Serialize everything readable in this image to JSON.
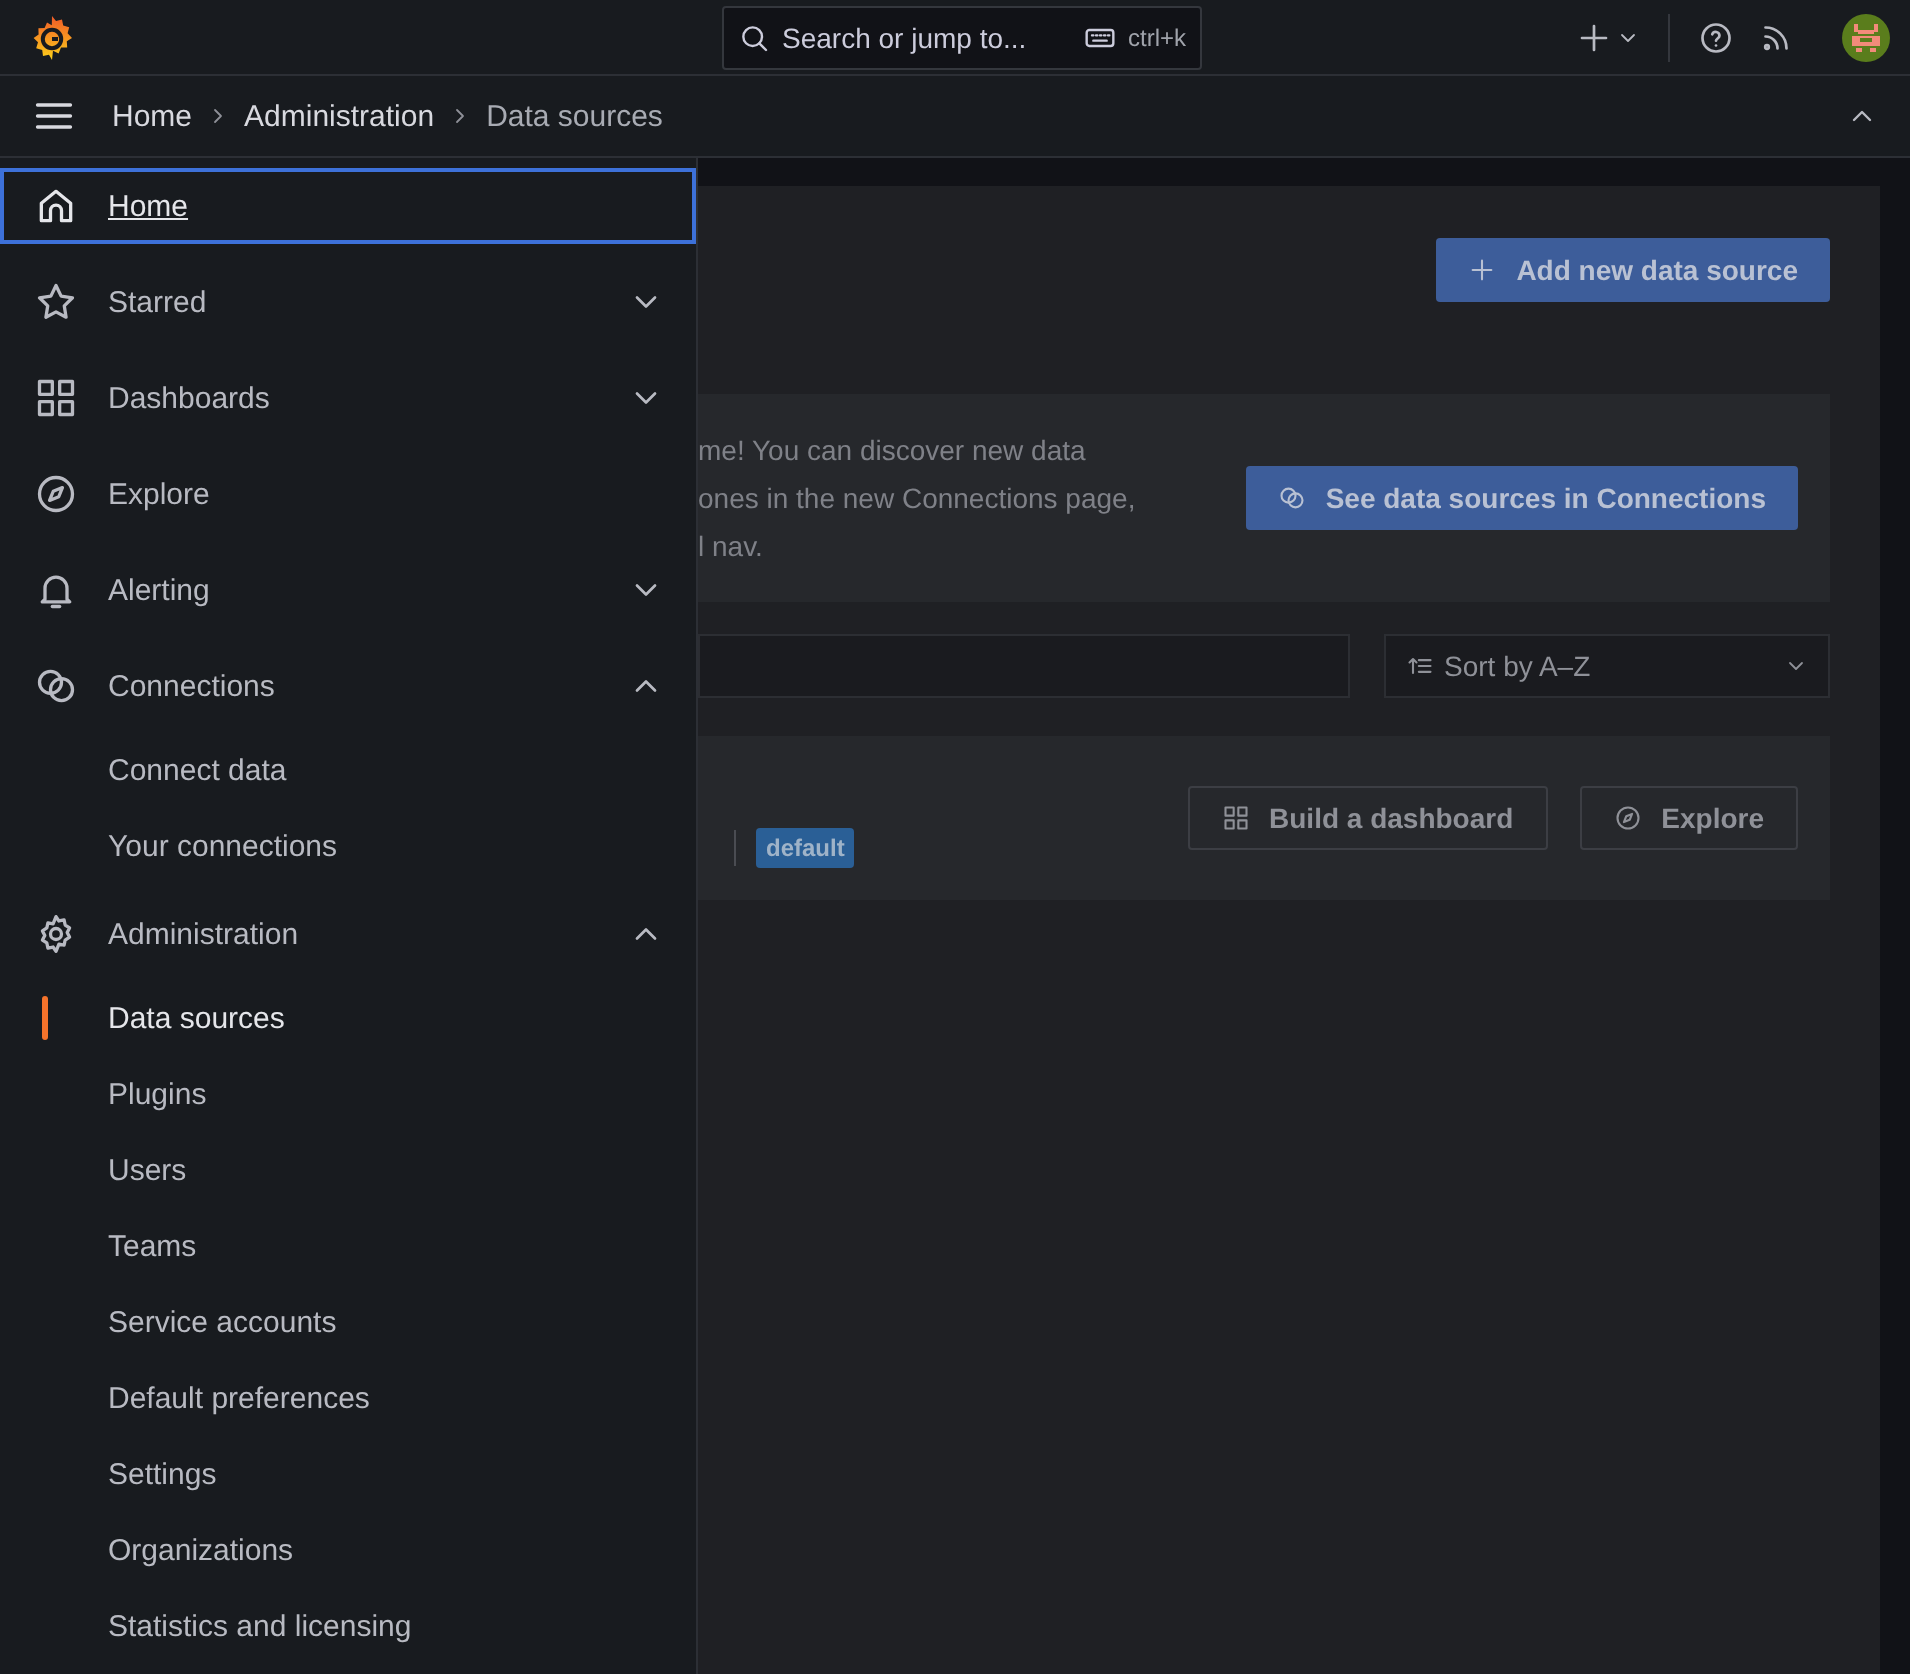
{
  "top_bar": {
    "search": {
      "placeholder": "Search or jump to...",
      "shortcut": "ctrl+k"
    }
  },
  "breadcrumbs": [
    {
      "label": "Home",
      "current": false
    },
    {
      "label": "Administration",
      "current": false
    },
    {
      "label": "Data sources",
      "current": true
    }
  ],
  "sidebar": {
    "items": [
      {
        "label": "Home",
        "focused": true
      },
      {
        "label": "Starred",
        "focused": false,
        "expanded": false
      },
      {
        "label": "Dashboards",
        "focused": false,
        "expanded": false
      },
      {
        "label": "Explore",
        "focused": false
      },
      {
        "label": "Alerting",
        "focused": false,
        "expanded": false
      },
      {
        "label": "Connections",
        "focused": false,
        "expanded": true,
        "children": [
          {
            "label": "Connect data",
            "selected": false
          },
          {
            "label": "Your connections",
            "selected": false
          }
        ]
      },
      {
        "label": "Administration",
        "focused": false,
        "expanded": true,
        "children": [
          {
            "label": "Data sources",
            "selected": true
          },
          {
            "label": "Plugins",
            "selected": false
          },
          {
            "label": "Users",
            "selected": false
          },
          {
            "label": "Teams",
            "selected": false
          },
          {
            "label": "Service accounts",
            "selected": false
          },
          {
            "label": "Default preferences",
            "selected": false
          },
          {
            "label": "Settings",
            "selected": false
          },
          {
            "label": "Organizations",
            "selected": false
          },
          {
            "label": "Statistics and licensing",
            "selected": false
          }
        ]
      }
    ]
  },
  "page": {
    "add_button": "Add new data source",
    "notice": {
      "lines": [
        "me! You can discover new data",
        "ones in the new Connections page,",
        "l nav."
      ],
      "button": "See data sources in Connections"
    },
    "sort": "Sort by A–Z",
    "data_source": {
      "badge": "default",
      "buttons": [
        "Build a dashboard",
        "Explore"
      ]
    }
  }
}
